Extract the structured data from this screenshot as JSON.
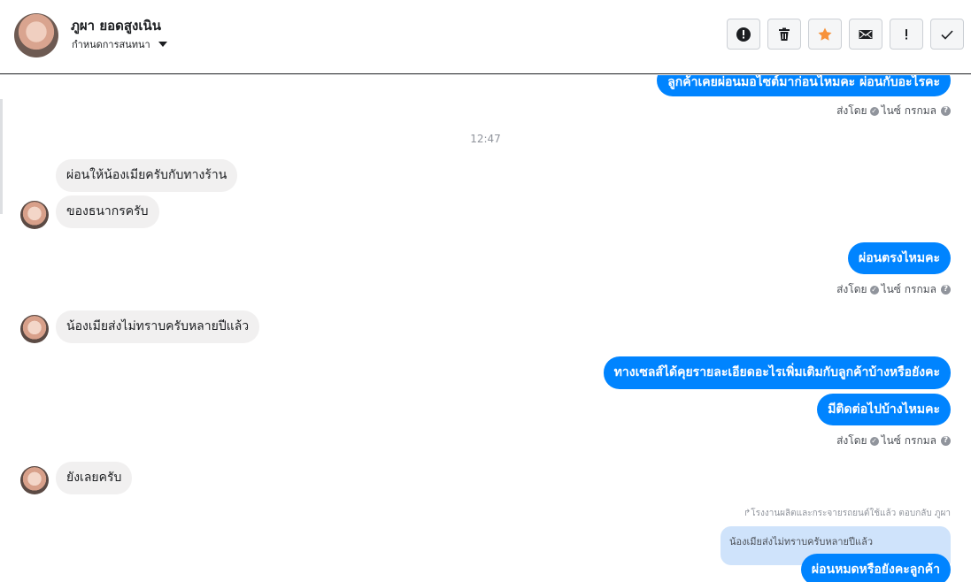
{
  "header": {
    "name": "ภูผา ยอดสูงเนิน",
    "subtitle": "กำหนดการสนทนา",
    "toolbar": [
      {
        "icon": "alert-circle-icon"
      },
      {
        "icon": "trash-icon"
      },
      {
        "icon": "star-icon",
        "color": "#f7923b"
      },
      {
        "icon": "envelope-icon"
      },
      {
        "icon": "exclamation-icon"
      },
      {
        "icon": "check-icon"
      }
    ]
  },
  "messages": {
    "out_top": "ลูกค้าเคยผ่อนมอไซต์มาก่อนไหมคะ ผ่อนกับอะไรคะ",
    "sentby_1": "ส่งโดย",
    "sender_1": "ไนซ์ กรกมล",
    "time": "12:47",
    "in_1": "ผ่อนให้น้องเมียครับกับทางร้าน",
    "in_2": "ของธนากรครับ",
    "out_2": "ผ่อนตรงไหมคะ",
    "sentby_2": "ส่งโดย",
    "sender_2": "ไนซ์ กรกมล",
    "in_3": "น้องเมียส่งไม่ทราบครับหลายปีแล้ว",
    "out_3": "ทางเซลส์ได้คุยรายละเอียดอะไรเพิ่มเติมกับลูกค้าบ้างหรือยังคะ",
    "out_4": "มีติดต่อไปบ้างไหมคะ",
    "sentby_3": "ส่งโดย",
    "sender_3": "ไนซ์ กรกมล",
    "in_4": "ยังเลยครับ",
    "replied_label": "โรงงานผลิตและกระจายรถยนต์ใช้แล้ว ตอบกลับ ภูผา",
    "quote": "น้องเมียส่งไม่ทราบครับหลายปีแล้ว",
    "out_5": "ผ่อนหมดหรือยังคะลูกค้า"
  },
  "colors": {
    "bubble_out": "#0084ff",
    "bubble_in": "#f1f0f0",
    "quote_bg": "#cfe3fb"
  }
}
